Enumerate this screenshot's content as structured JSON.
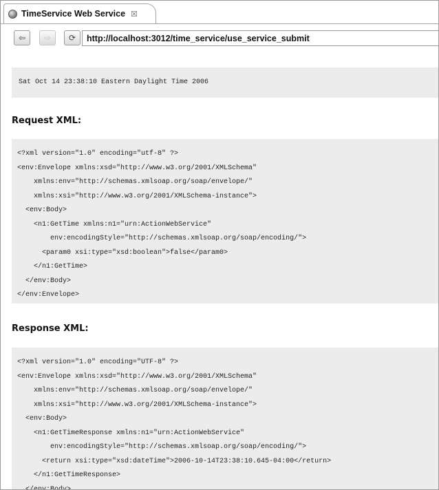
{
  "tab": {
    "title": "TimeService Web Service",
    "close_glyph": "☒"
  },
  "nav": {
    "back_glyph": "⇦",
    "forward_glyph": "⇨",
    "refresh_glyph": "⟳",
    "url": "http://localhost:3012/time_service/use_service_submit"
  },
  "page": {
    "date": "Sat Oct 14 23:38:10 Eastern Daylight Time 2006",
    "request_heading": "Request XML:",
    "request_lines": [
      "<?xml version=\"1.0\" encoding=\"utf-8\" ?>",
      "<env:Envelope xmlns:xsd=\"http://www.w3.org/2001/XMLSchema\"",
      "    xmlns:env=\"http://schemas.xmlsoap.org/soap/envelope/\"",
      "    xmlns:xsi=\"http://www.w3.org/2001/XMLSchema-instance\">",
      "  <env:Body>",
      "    <n1:GetTime xmlns:n1=\"urn:ActionWebService\"",
      "        env:encodingStyle=\"http://schemas.xmlsoap.org/soap/encoding/\">",
      "      <param0 xsi:type=\"xsd:boolean\">false</param0>",
      "    </n1:GetTime>",
      "  </env:Body>",
      "</env:Envelope>"
    ],
    "response_heading": "Response XML:",
    "response_lines": [
      "<?xml version=\"1.0\" encoding=\"UTF-8\" ?>",
      "<env:Envelope xmlns:xsd=\"http://www.w3.org/2001/XMLSchema\"",
      "    xmlns:env=\"http://schemas.xmlsoap.org/soap/envelope/\"",
      "    xmlns:xsi=\"http://www.w3.org/2001/XMLSchema-instance\">",
      "  <env:Body>",
      "    <n1:GetTimeResponse xmlns:n1=\"urn:ActionWebService\"",
      "        env:encodingStyle=\"http://schemas.xmlsoap.org/soap/encoding/\">",
      "      <return xsi:type=\"xsd:dateTime\">2006-10-14T23:38:10.645-04:00</return>",
      "    </n1:GetTimeResponse>",
      "  </env:Body>"
    ]
  }
}
